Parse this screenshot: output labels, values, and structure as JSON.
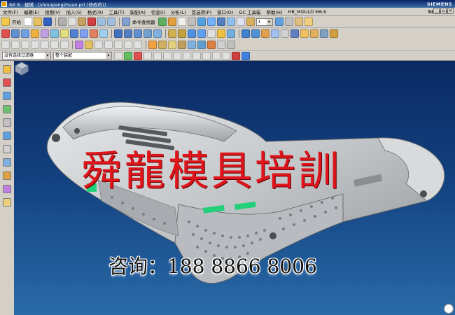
{
  "window": {
    "title": "NX 8 - 建模 - [shouqiangzhuan.prt (修改的)]",
    "brand": "SIEMENS"
  },
  "menu": {
    "items": [
      "文件(F)",
      "编辑(E)",
      "视图(V)",
      "插入(S)",
      "格式(R)",
      "工具(T)",
      "装配(A)",
      "信息(I)",
      "分析(L)",
      "首选项(P)",
      "窗口(O)",
      "GC 工具箱",
      "帮助(H)",
      "HB_MOULD M6.6"
    ],
    "brand": "SIEMENS"
  },
  "toolbar": {
    "start_label": "开始",
    "command_finder_label": "命令查找器",
    "layer_value": "1"
  },
  "filter": {
    "type_value": "没有选择过滤器",
    "scope_value": "整个装配"
  },
  "overlay": {
    "watermark": "舜龍模具培訓",
    "contact": "咨询：188 8866 8006"
  },
  "colors": {
    "titlebar": "#0a246a",
    "viewport_top": "#0b2a63",
    "viewport_bottom": "#2a6aa8",
    "watermark": "#e0151b",
    "model": "#c9ccce",
    "model_accent": "#22d07a"
  }
}
